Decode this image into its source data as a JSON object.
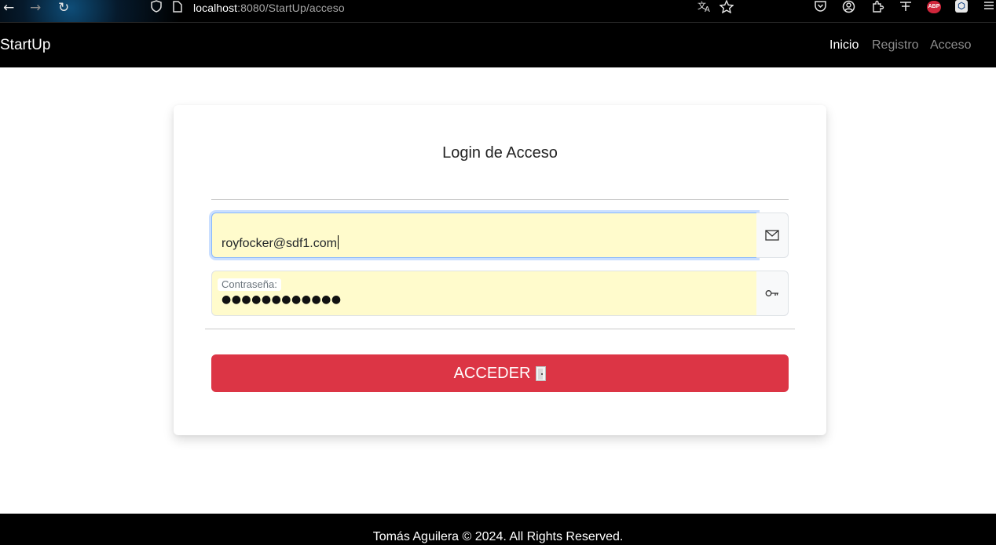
{
  "browser": {
    "back_icon": "←",
    "forward_icon": "→",
    "reload_icon": "↻",
    "shield_icon": "shield",
    "page_icon": "page",
    "url_host": "localhost",
    "url_rest": ":8080/StartUp/acceso",
    "abp_label": "ABP",
    "ext_label": "⬡"
  },
  "navbar": {
    "brand": "StartUp",
    "links": [
      {
        "label": "Inicio",
        "active": true
      },
      {
        "label": "Registro",
        "active": false
      },
      {
        "label": "Acceso",
        "active": false
      }
    ]
  },
  "login": {
    "title": "Login de Acceso",
    "email_value": "royfocker@sdf1.com",
    "email_icon": "envelope-icon",
    "password_label": "Contraseña:",
    "password_dots": "●●●●●●●●●●●●",
    "password_icon": "key-icon",
    "submit_label": "ACCEDER"
  },
  "footer": {
    "text": "Tomás Aguilera © 2024. All Rights Reserved."
  }
}
